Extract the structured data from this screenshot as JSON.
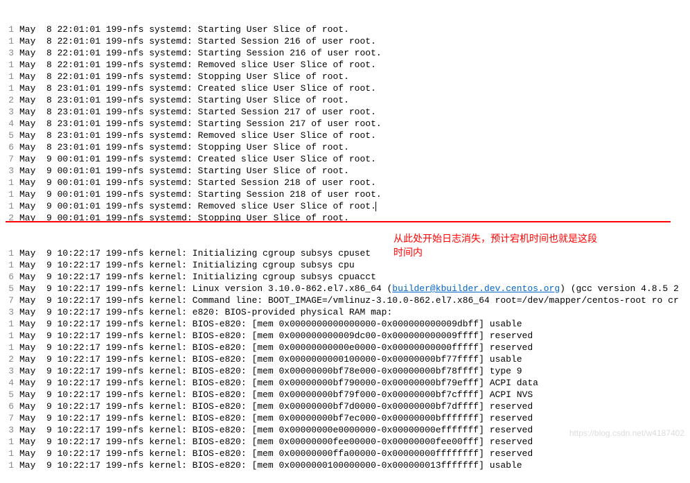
{
  "lines_before": [
    {
      "num": "1",
      "text": "May  8 22:01:01 199-nfs systemd: Starting User Slice of root."
    },
    {
      "num": "1",
      "text": "May  8 22:01:01 199-nfs systemd: Started Session 216 of user root."
    },
    {
      "num": "3",
      "text": "May  8 22:01:01 199-nfs systemd: Starting Session 216 of user root."
    },
    {
      "num": "1",
      "text": "May  8 22:01:01 199-nfs systemd: Removed slice User Slice of root."
    },
    {
      "num": "1",
      "text": "May  8 22:01:01 199-nfs systemd: Stopping User Slice of root."
    },
    {
      "num": "1",
      "text": "May  8 23:01:01 199-nfs systemd: Created slice User Slice of root."
    },
    {
      "num": "2",
      "text": "May  8 23:01:01 199-nfs systemd: Starting User Slice of root."
    },
    {
      "num": "3",
      "text": "May  8 23:01:01 199-nfs systemd: Started Session 217 of user root."
    },
    {
      "num": "4",
      "text": "May  8 23:01:01 199-nfs systemd: Starting Session 217 of user root."
    },
    {
      "num": "5",
      "text": "May  8 23:01:01 199-nfs systemd: Removed slice User Slice of root."
    },
    {
      "num": "6",
      "text": "May  8 23:01:01 199-nfs systemd: Stopping User Slice of root."
    },
    {
      "num": "7",
      "text": "May  9 00:01:01 199-nfs systemd: Created slice User Slice of root."
    },
    {
      "num": "3",
      "text": "May  9 00:01:01 199-nfs systemd: Starting User Slice of root."
    },
    {
      "num": "1",
      "text": "May  9 00:01:01 199-nfs systemd: Started Session 218 of user root."
    },
    {
      "num": "1",
      "text": "May  9 00:01:01 199-nfs systemd: Starting Session 218 of user root."
    },
    {
      "num": "1",
      "text": "May  9 00:01:01 199-nfs systemd: Removed slice User Slice of root."
    },
    {
      "num": "2",
      "text": "May  9 00:01:01 199-nfs systemd: Stopping User Slice of root."
    }
  ],
  "cursor_line_index": 15,
  "lines_after_part1": {
    "num": "1",
    "text": "May  9 10:22:17 199-nfs kernel: Initializing cgroup subsys cpuset"
  },
  "lines_after_part2": {
    "num": "1",
    "text": "May  9 10:22:17 199-nfs kernel: Initializing cgroup subsys cpu"
  },
  "lines_after_part3": {
    "num": "6",
    "text": "May  9 10:22:17 199-nfs kernel: Initializing cgroup subsys cpuacct"
  },
  "linux_version_line": {
    "num": "5",
    "prefix": "May  9 10:22:17 199-nfs kernel: Linux version 3.10.0-862.el7.x86_64 (",
    "link": "builder@kbuilder.dev.centos.org",
    "suffix": ") (gcc version 4.8.5 2"
  },
  "lines_after_rest": [
    {
      "num": "7",
      "text": "May  9 10:22:17 199-nfs kernel: Command line: BOOT_IMAGE=/vmlinuz-3.10.0-862.el7.x86_64 root=/dev/mapper/centos-root ro cr"
    },
    {
      "num": "3",
      "text": "May  9 10:22:17 199-nfs kernel: e820: BIOS-provided physical RAM map:"
    },
    {
      "num": "1",
      "text": "May  9 10:22:17 199-nfs kernel: BIOS-e820: [mem 0x0000000000000000-0x000000000009dbff] usable"
    },
    {
      "num": "1",
      "text": "May  9 10:22:17 199-nfs kernel: BIOS-e820: [mem 0x000000000009dc00-0x000000000009ffff] reserved"
    },
    {
      "num": "1",
      "text": "May  9 10:22:17 199-nfs kernel: BIOS-e820: [mem 0x00000000000e0000-0x00000000000fffff] reserved"
    },
    {
      "num": "2",
      "text": "May  9 10:22:17 199-nfs kernel: BIOS-e820: [mem 0x0000000000100000-0x00000000bf77ffff] usable"
    },
    {
      "num": "3",
      "text": "May  9 10:22:17 199-nfs kernel: BIOS-e820: [mem 0x00000000bf78e000-0x00000000bf78ffff] type 9"
    },
    {
      "num": "4",
      "text": "May  9 10:22:17 199-nfs kernel: BIOS-e820: [mem 0x00000000bf790000-0x00000000bf79efff] ACPI data"
    },
    {
      "num": "5",
      "text": "May  9 10:22:17 199-nfs kernel: BIOS-e820: [mem 0x00000000bf79f000-0x00000000bf7cffff] ACPI NVS"
    },
    {
      "num": "6",
      "text": "May  9 10:22:17 199-nfs kernel: BIOS-e820: [mem 0x00000000bf7d0000-0x00000000bf7dffff] reserved"
    },
    {
      "num": "7",
      "text": "May  9 10:22:17 199-nfs kernel: BIOS-e820: [mem 0x00000000bf7ec000-0x00000000bfffffff] reserved"
    },
    {
      "num": "3",
      "text": "May  9 10:22:17 199-nfs kernel: BIOS-e820: [mem 0x00000000e0000000-0x00000000efffffff] reserved"
    },
    {
      "num": "1",
      "text": "May  9 10:22:17 199-nfs kernel: BIOS-e820: [mem 0x00000000fee00000-0x00000000fee00fff] reserved"
    },
    {
      "num": "1",
      "text": "May  9 10:22:17 199-nfs kernel: BIOS-e820: [mem 0x00000000ffa00000-0x00000000ffffffff] reserved"
    },
    {
      "num": "1",
      "text": "May  9 10:22:17 199-nfs kernel: BIOS-e820: [mem 0x0000000100000000-0x000000013fffffff] usable"
    }
  ],
  "annotation_line1": "从此处开始日志消失，预计宕机时间也就是这段",
  "annotation_line2": "时间内",
  "watermark": "https://blog.csdn.net/w4187402"
}
